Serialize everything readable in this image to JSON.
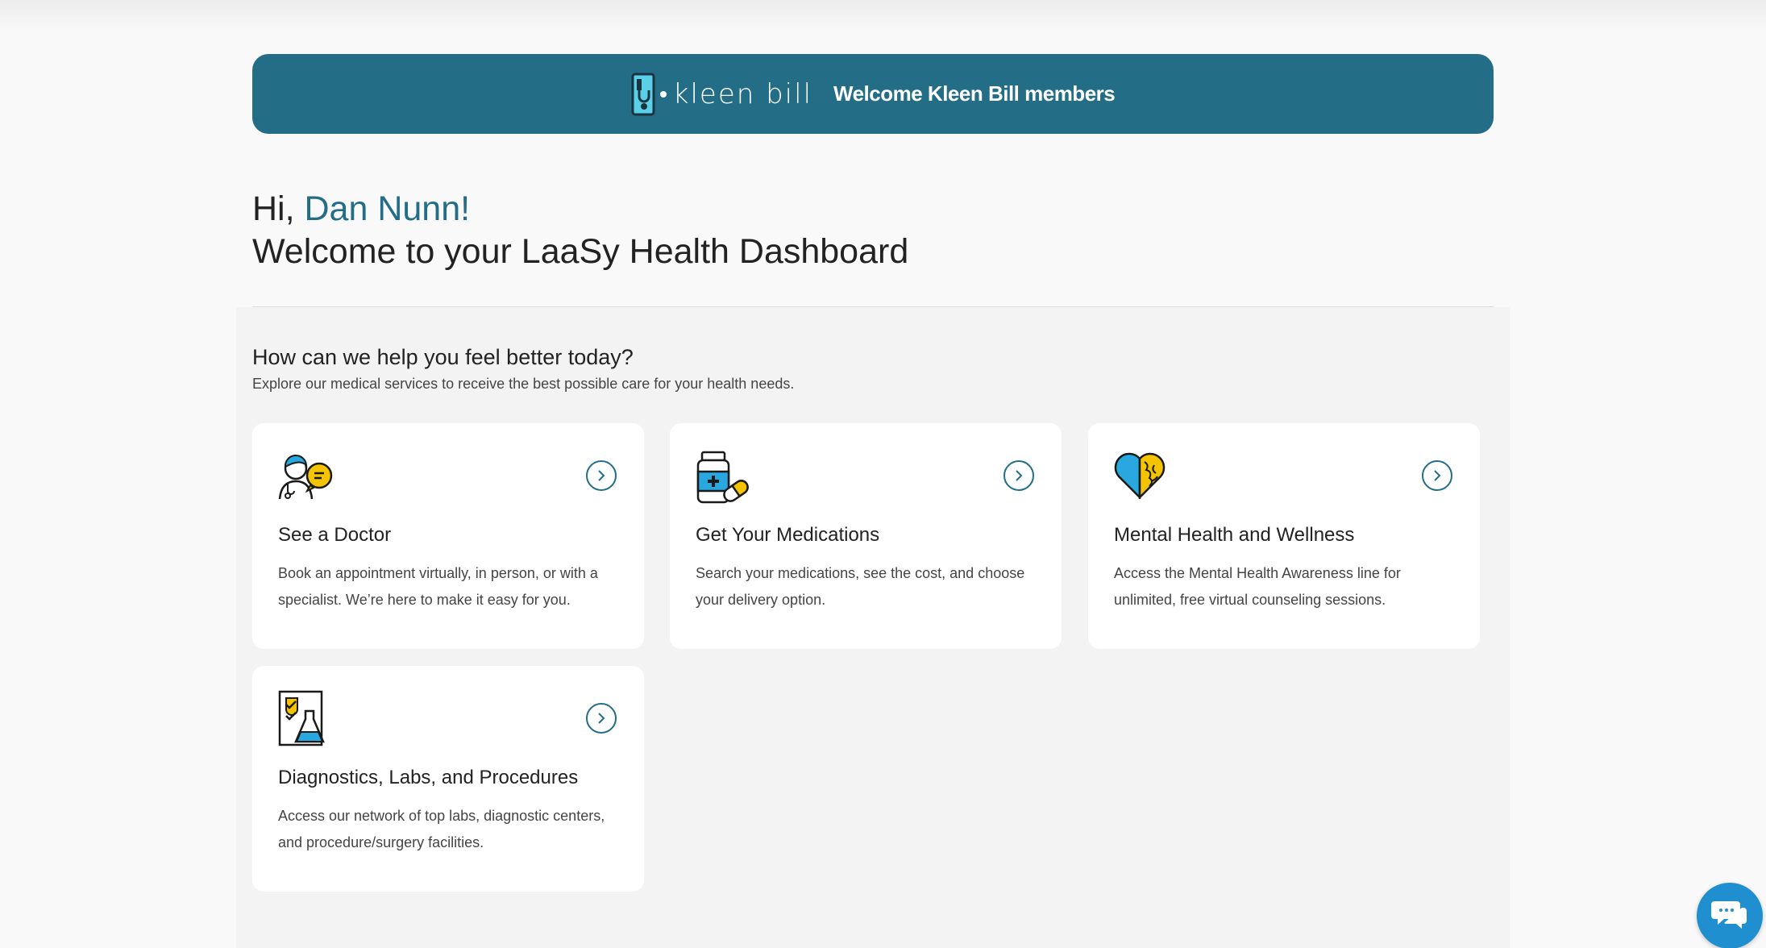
{
  "banner": {
    "brand_name": "kleen bill",
    "welcome_text": "Welcome Kleen Bill members"
  },
  "header": {
    "greeting_prefix": "Hi, ",
    "user_name": "Dan Nunn!",
    "dashboard_title": "Welcome to your LaaSy Health Dashboard"
  },
  "services": {
    "title": "How can we help you feel better today?",
    "subtitle": "Explore our medical services to receive the best possible care for your health needs.",
    "cards": [
      {
        "title": "See a Doctor",
        "description": "Book an appointment virtually, in person, or with a specialist. We’re here to make it easy for you.",
        "icon": "doctor-icon"
      },
      {
        "title": "Get Your Medications",
        "description": "Search your medications, see the cost, and choose your delivery option.",
        "icon": "medication-icon"
      },
      {
        "title": "Mental Health and Wellness",
        "description": "Access the Mental Health Awareness line for unlimited, free virtual counseling sessions.",
        "icon": "heart-brain-icon"
      },
      {
        "title": "Diagnostics, Labs, and Procedures",
        "description": "Access our network of top labs, diagnostic centers, and procedure/surgery facilities.",
        "icon": "lab-icon"
      }
    ]
  },
  "colors": {
    "primary": "#236d87",
    "accent_yellow": "#f5c400",
    "accent_blue": "#29a8df",
    "chat": "#1f8fd0"
  }
}
